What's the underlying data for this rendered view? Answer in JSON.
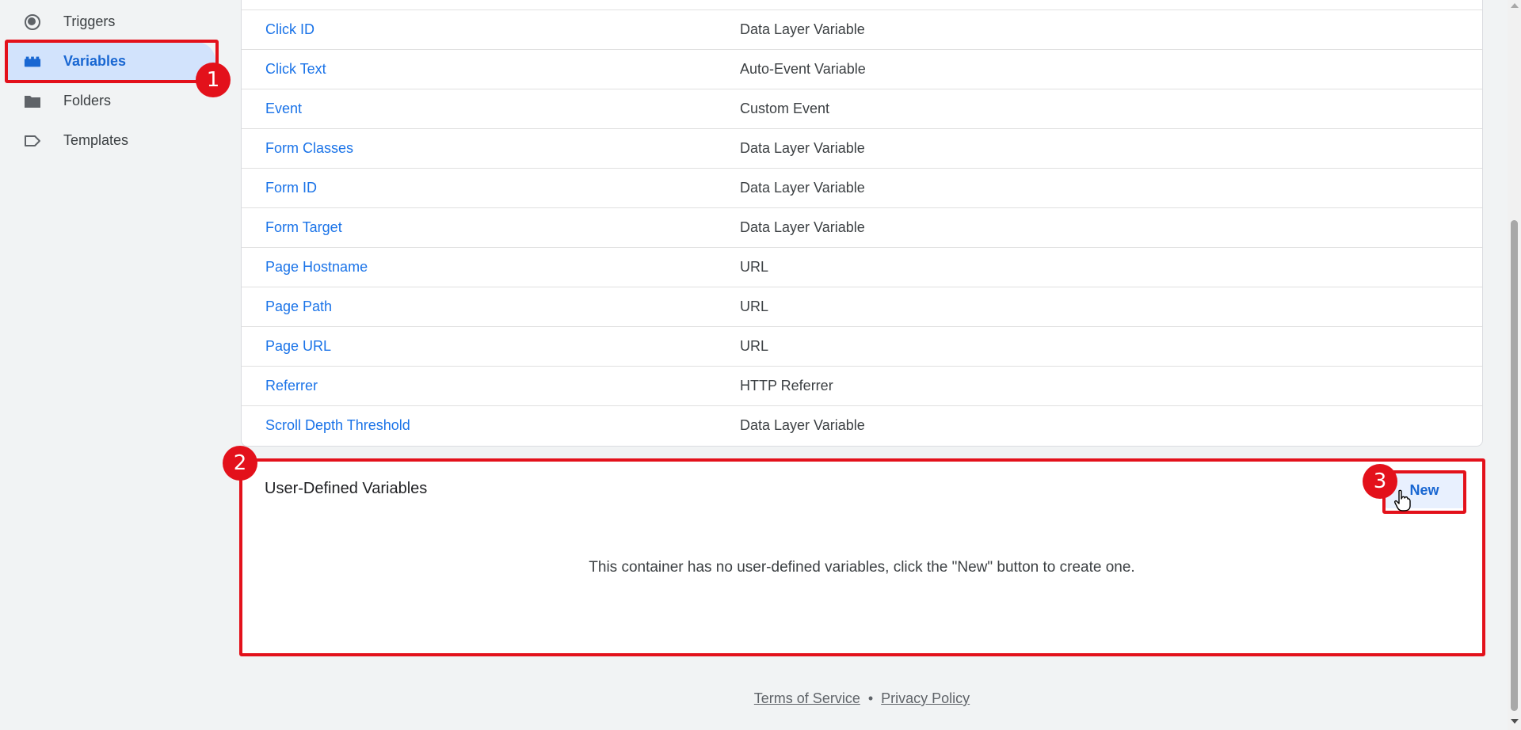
{
  "sidebar": {
    "items": [
      {
        "label": "Triggers",
        "icon": "triggers-icon"
      },
      {
        "label": "Variables",
        "icon": "variables-icon",
        "active": true
      },
      {
        "label": "Folders",
        "icon": "folder-icon"
      },
      {
        "label": "Templates",
        "icon": "templates-icon"
      }
    ]
  },
  "builtin_variables": {
    "rows": [
      {
        "name": "Click ID",
        "type": "Data Layer Variable"
      },
      {
        "name": "Click Text",
        "type": "Auto-Event Variable"
      },
      {
        "name": "Event",
        "type": "Custom Event"
      },
      {
        "name": "Form Classes",
        "type": "Data Layer Variable"
      },
      {
        "name": "Form ID",
        "type": "Data Layer Variable"
      },
      {
        "name": "Form Target",
        "type": "Data Layer Variable"
      },
      {
        "name": "Page Hostname",
        "type": "URL"
      },
      {
        "name": "Page Path",
        "type": "URL"
      },
      {
        "name": "Page URL",
        "type": "URL"
      },
      {
        "name": "Referrer",
        "type": "HTTP Referrer"
      },
      {
        "name": "Scroll Depth Threshold",
        "type": "Data Layer Variable"
      }
    ]
  },
  "user_defined": {
    "title": "User-Defined Variables",
    "empty_message": "This container has no user-defined variables, click the \"New\" button to create one.",
    "new_button_label": "New"
  },
  "annotations": {
    "badge_1": "1",
    "badge_2": "2",
    "badge_3": "3"
  },
  "footer": {
    "terms_label": "Terms of Service",
    "separator": "•",
    "privacy_label": "Privacy Policy"
  },
  "colors": {
    "accent": "#1a73e8",
    "highlight": "#e3111b",
    "active_nav_bg": "#d2e3fc"
  }
}
